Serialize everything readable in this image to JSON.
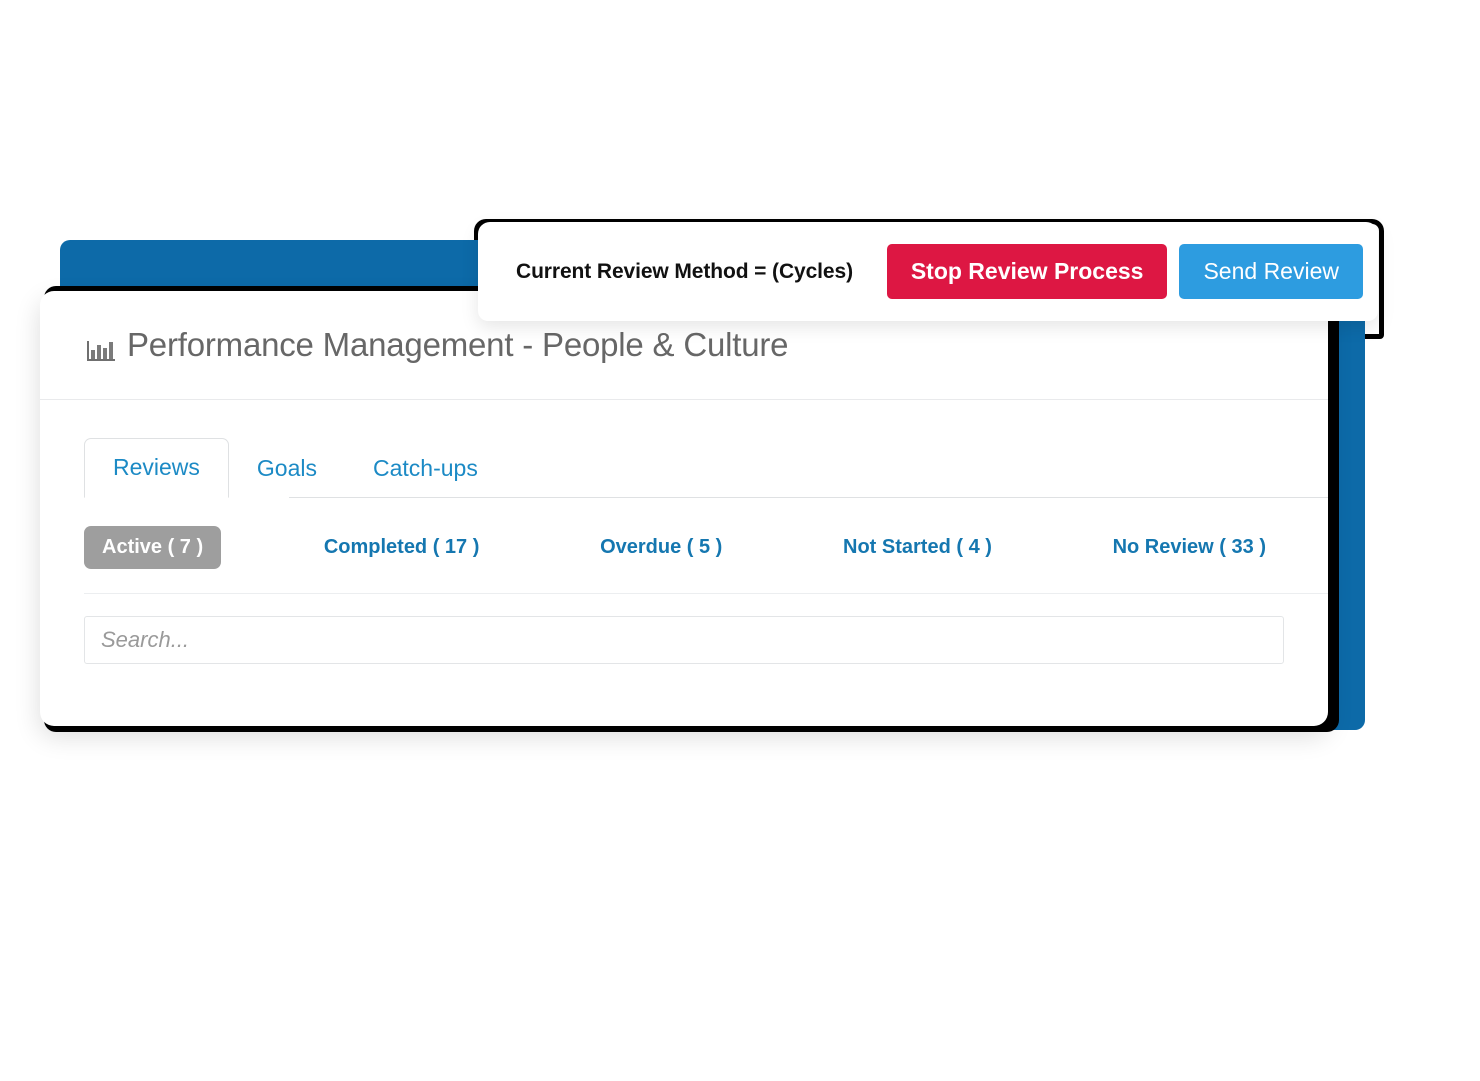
{
  "header": {
    "icon": "bar-chart-icon",
    "title": "Performance Management - People & Culture"
  },
  "toolbar": {
    "method_label": "Current Review Method = (Cycles)",
    "stop_button": "Stop Review Process",
    "send_button": "Send Review",
    "stop_color": "#dd1743",
    "send_color": "#2d9ce0"
  },
  "tabs": [
    {
      "label": "Reviews",
      "active": true
    },
    {
      "label": "Goals",
      "active": false
    },
    {
      "label": "Catch-ups",
      "active": false
    }
  ],
  "filters": [
    {
      "label": "Active",
      "count": "( 7 )",
      "selected": true
    },
    {
      "label": "Completed",
      "count": "( 17 )",
      "selected": false
    },
    {
      "label": "Overdue",
      "count": "( 5 )",
      "selected": false
    },
    {
      "label": "Not Started",
      "count": "( 4 )",
      "selected": false
    },
    {
      "label": "No Review",
      "count": "( 33 )",
      "selected": false
    }
  ],
  "search": {
    "value": "",
    "placeholder": "Search..."
  },
  "colors": {
    "link_blue": "#1c8ac5",
    "pill_blue": "#1577b0",
    "pill_selected_bg": "#9e9e9e",
    "title_gray": "#676767",
    "accent_blue_backdrop": "#0d6aa8"
  }
}
